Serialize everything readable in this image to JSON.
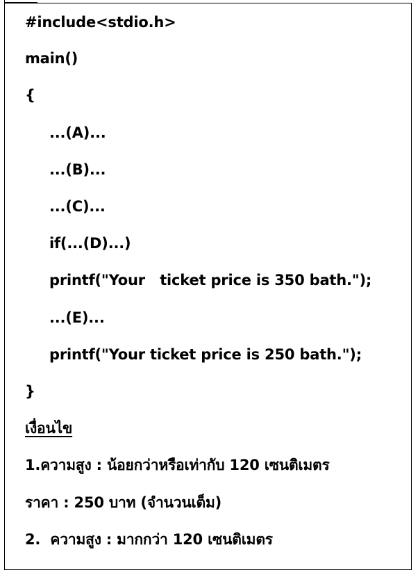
{
  "code": {
    "include": "#include<stdio.h>",
    "main": "main()",
    "open_brace": "{",
    "a": "...(A)...",
    "b": "...(B)...",
    "c": "...(C)...",
    "if_line": "if(...(D)...)",
    "printf_350": "printf(\"Your   ticket price is 350 bath.\");",
    "e": "...(E)...",
    "printf_250": "printf(\"Your ticket price is 250 bath.\");",
    "close_brace": "}"
  },
  "conditions": {
    "heading": "เงื่อนไข",
    "line1": "1.ความสูง : น้อยกว่าหรือเท่ากับ 120 เซนติเมตร",
    "line2": "ราคา : 250 บาท (จำนวนเต็ม)",
    "line3": "2.  ความสูง : มากกว่า 120 เซนติเมตร"
  }
}
